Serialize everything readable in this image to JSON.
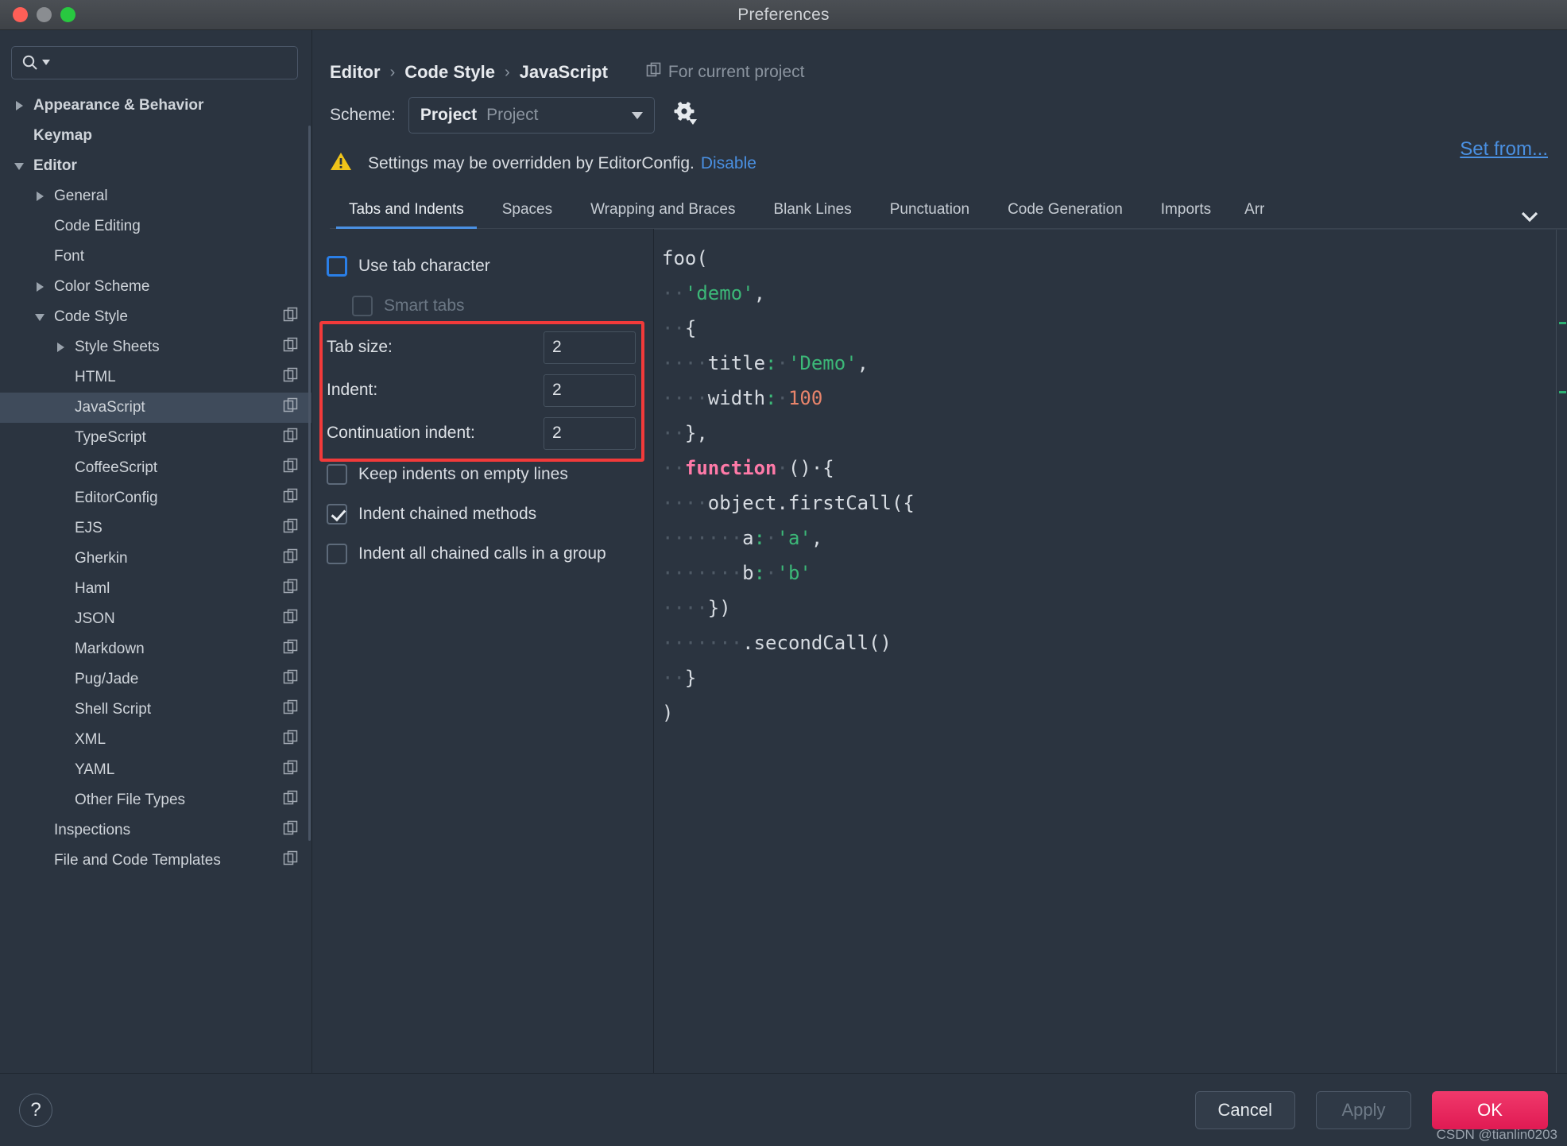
{
  "window": {
    "title": "Preferences",
    "traffic_lights": [
      "close-red",
      "minimize-yellow",
      "zoom-green"
    ]
  },
  "sidebar": {
    "search": {
      "value": "",
      "placeholder": ""
    },
    "items": [
      {
        "label": "Appearance & Behavior",
        "indent": 0,
        "arrow": "right",
        "bold": true,
        "copy": false,
        "selected": false
      },
      {
        "label": "Keymap",
        "indent": 0,
        "arrow": "none",
        "bold": true,
        "copy": false,
        "selected": false
      },
      {
        "label": "Editor",
        "indent": 0,
        "arrow": "down",
        "bold": true,
        "copy": false,
        "selected": false
      },
      {
        "label": "General",
        "indent": 1,
        "arrow": "right",
        "bold": false,
        "copy": false,
        "selected": false
      },
      {
        "label": "Code Editing",
        "indent": 1,
        "arrow": "none",
        "bold": false,
        "copy": false,
        "selected": false
      },
      {
        "label": "Font",
        "indent": 1,
        "arrow": "none",
        "bold": false,
        "copy": false,
        "selected": false
      },
      {
        "label": "Color Scheme",
        "indent": 1,
        "arrow": "right",
        "bold": false,
        "copy": false,
        "selected": false
      },
      {
        "label": "Code Style",
        "indent": 1,
        "arrow": "down",
        "bold": false,
        "copy": true,
        "selected": false
      },
      {
        "label": "Style Sheets",
        "indent": 2,
        "arrow": "right",
        "bold": false,
        "copy": true,
        "selected": false
      },
      {
        "label": "HTML",
        "indent": 2,
        "arrow": "none",
        "bold": false,
        "copy": true,
        "selected": false
      },
      {
        "label": "JavaScript",
        "indent": 2,
        "arrow": "none",
        "bold": false,
        "copy": true,
        "selected": true
      },
      {
        "label": "TypeScript",
        "indent": 2,
        "arrow": "none",
        "bold": false,
        "copy": true,
        "selected": false
      },
      {
        "label": "CoffeeScript",
        "indent": 2,
        "arrow": "none",
        "bold": false,
        "copy": true,
        "selected": false
      },
      {
        "label": "EditorConfig",
        "indent": 2,
        "arrow": "none",
        "bold": false,
        "copy": true,
        "selected": false
      },
      {
        "label": "EJS",
        "indent": 2,
        "arrow": "none",
        "bold": false,
        "copy": true,
        "selected": false
      },
      {
        "label": "Gherkin",
        "indent": 2,
        "arrow": "none",
        "bold": false,
        "copy": true,
        "selected": false
      },
      {
        "label": "Haml",
        "indent": 2,
        "arrow": "none",
        "bold": false,
        "copy": true,
        "selected": false
      },
      {
        "label": "JSON",
        "indent": 2,
        "arrow": "none",
        "bold": false,
        "copy": true,
        "selected": false
      },
      {
        "label": "Markdown",
        "indent": 2,
        "arrow": "none",
        "bold": false,
        "copy": true,
        "selected": false
      },
      {
        "label": "Pug/Jade",
        "indent": 2,
        "arrow": "none",
        "bold": false,
        "copy": true,
        "selected": false
      },
      {
        "label": "Shell Script",
        "indent": 2,
        "arrow": "none",
        "bold": false,
        "copy": true,
        "selected": false
      },
      {
        "label": "XML",
        "indent": 2,
        "arrow": "none",
        "bold": false,
        "copy": true,
        "selected": false
      },
      {
        "label": "YAML",
        "indent": 2,
        "arrow": "none",
        "bold": false,
        "copy": true,
        "selected": false
      },
      {
        "label": "Other File Types",
        "indent": 2,
        "arrow": "none",
        "bold": false,
        "copy": true,
        "selected": false
      },
      {
        "label": "Inspections",
        "indent": 1,
        "arrow": "none",
        "bold": false,
        "copy": true,
        "selected": false
      },
      {
        "label": "File and Code Templates",
        "indent": 1,
        "arrow": "none",
        "bold": false,
        "copy": true,
        "selected": false
      }
    ]
  },
  "main": {
    "breadcrumb": {
      "part1": "Editor",
      "part2": "Code Style",
      "part3": "JavaScript",
      "separator": "›"
    },
    "for_current_project": "For current project",
    "scheme": {
      "label": "Scheme:",
      "value": "Project",
      "hint": "Project"
    },
    "set_from_link": "Set from...",
    "warning": {
      "text": "Settings may be overridden by EditorConfig.",
      "link": "Disable"
    },
    "tabs": [
      {
        "label": "Tabs and Indents",
        "active": true
      },
      {
        "label": "Spaces",
        "active": false
      },
      {
        "label": "Wrapping and Braces",
        "active": false
      },
      {
        "label": "Blank Lines",
        "active": false
      },
      {
        "label": "Punctuation",
        "active": false
      },
      {
        "label": "Code Generation",
        "active": false
      },
      {
        "label": "Imports",
        "active": false
      },
      {
        "label": "Arrangement",
        "active": false,
        "clipped": "Arr"
      }
    ],
    "options": {
      "use_tab_character": {
        "label": "Use tab character",
        "checked": false,
        "focused": true,
        "disabled": false
      },
      "smart_tabs": {
        "label": "Smart tabs",
        "checked": false,
        "focused": false,
        "disabled": true
      },
      "tab_size": {
        "label": "Tab size:",
        "value": "2"
      },
      "indent": {
        "label": "Indent:",
        "value": "2"
      },
      "continuation_indent": {
        "label": "Continuation indent:",
        "value": "2"
      },
      "keep_indents": {
        "label": "Keep indents on empty lines",
        "checked": false
      },
      "indent_chained": {
        "label": "Indent chained methods",
        "checked": true
      },
      "indent_all": {
        "label": "Indent all chained calls in a group",
        "checked": false
      }
    },
    "highlight_color": "#f23a3a"
  },
  "preview_code": {
    "language": "javascript",
    "lines": [
      [
        {
          "t": "foo(",
          "c": "plain"
        }
      ],
      [
        {
          "t": "··",
          "c": "ws"
        },
        {
          "t": "'demo'",
          "c": "str"
        },
        {
          "t": ",",
          "c": "plain"
        }
      ],
      [
        {
          "t": "··",
          "c": "ws"
        },
        {
          "t": "{",
          "c": "plain"
        }
      ],
      [
        {
          "t": "····",
          "c": "ws"
        },
        {
          "t": "title",
          "c": "plain"
        },
        {
          "t": ":",
          "c": "pn"
        },
        {
          "t": "·",
          "c": "ws"
        },
        {
          "t": "'Demo'",
          "c": "str"
        },
        {
          "t": ",",
          "c": "plain"
        }
      ],
      [
        {
          "t": "····",
          "c": "ws"
        },
        {
          "t": "width",
          "c": "plain"
        },
        {
          "t": ":",
          "c": "pn"
        },
        {
          "t": "·",
          "c": "ws"
        },
        {
          "t": "100",
          "c": "num"
        }
      ],
      [
        {
          "t": "··",
          "c": "ws"
        },
        {
          "t": "},",
          "c": "plain"
        }
      ],
      [
        {
          "t": "··",
          "c": "ws"
        },
        {
          "t": "function",
          "c": "kw"
        },
        {
          "t": "·",
          "c": "ws"
        },
        {
          "t": "()·{",
          "c": "plain"
        }
      ],
      [
        {
          "t": "····",
          "c": "ws"
        },
        {
          "t": "object.firstCall({",
          "c": "plain"
        }
      ],
      [
        {
          "t": "·······",
          "c": "ws"
        },
        {
          "t": "a",
          "c": "plain"
        },
        {
          "t": ":",
          "c": "pn"
        },
        {
          "t": "·",
          "c": "ws"
        },
        {
          "t": "'a'",
          "c": "str"
        },
        {
          "t": ",",
          "c": "plain"
        }
      ],
      [
        {
          "t": "·······",
          "c": "ws"
        },
        {
          "t": "b",
          "c": "plain"
        },
        {
          "t": ":",
          "c": "pn"
        },
        {
          "t": "·",
          "c": "ws"
        },
        {
          "t": "'b'",
          "c": "str"
        }
      ],
      [
        {
          "t": "····",
          "c": "ws"
        },
        {
          "t": "})",
          "c": "plain"
        }
      ],
      [
        {
          "t": "·······",
          "c": "ws"
        },
        {
          "t": ".secondCall()",
          "c": "plain"
        }
      ],
      [
        {
          "t": "··",
          "c": "ws"
        },
        {
          "t": "}",
          "c": "plain"
        }
      ],
      [
        {
          "t": ")",
          "c": "plain"
        }
      ]
    ],
    "colors": {
      "string": "#3cb878",
      "number": "#e8846b",
      "keyword": "#ff7aa8",
      "plain": "#d6dbe1",
      "whitespace_dot": "#4f5a66"
    }
  },
  "footer": {
    "help": "?",
    "cancel": "Cancel",
    "apply": "Apply",
    "apply_disabled": true,
    "ok": "OK",
    "ok_color": "#e01a53"
  },
  "watermark": "CSDN @tianlin0203"
}
